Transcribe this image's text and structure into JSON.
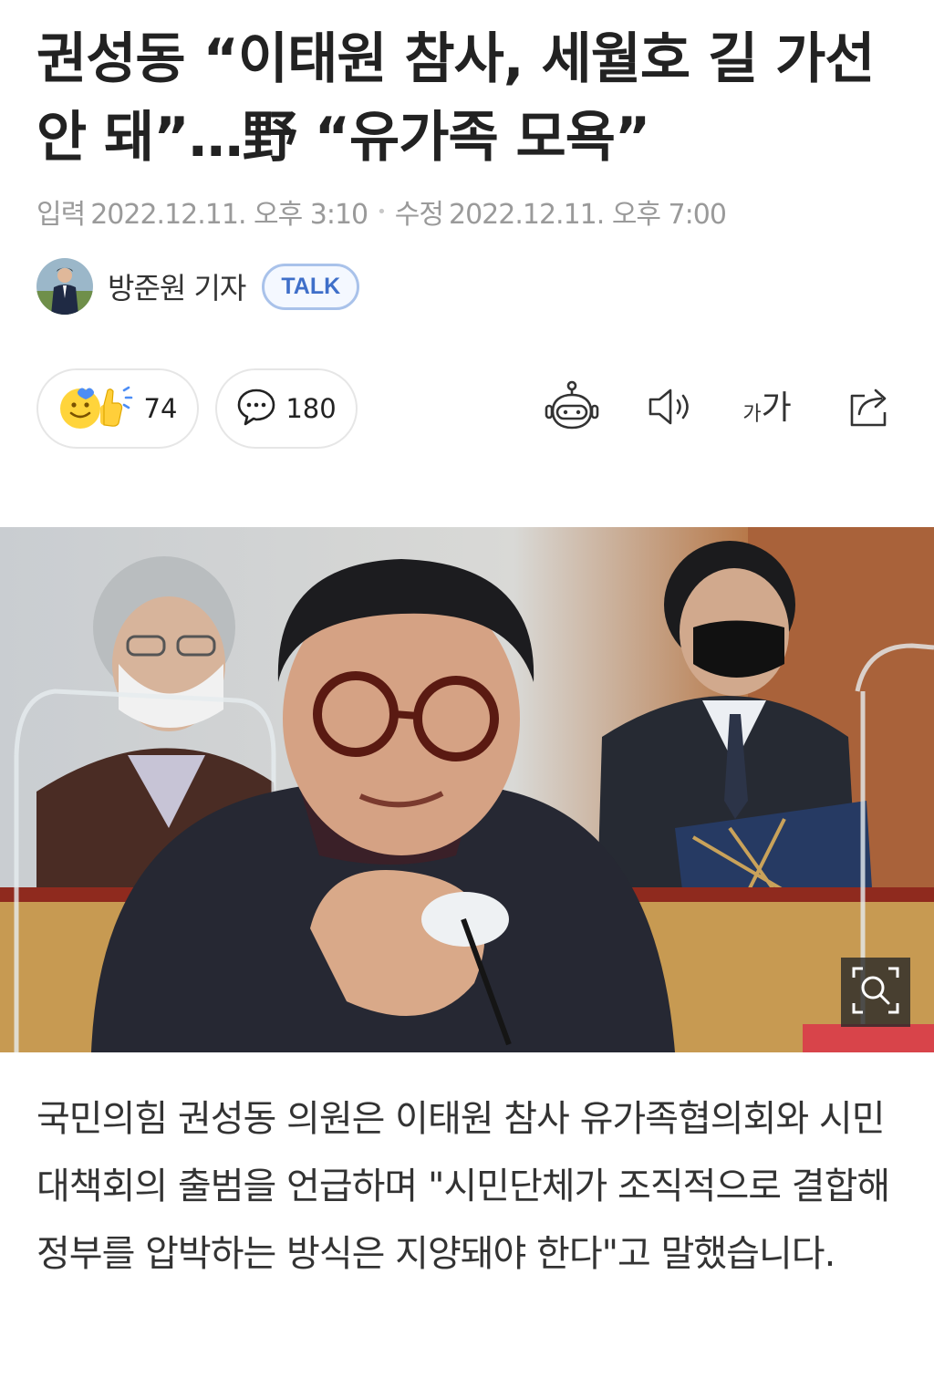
{
  "article": {
    "headline": "권성동 “이태원 참사, 세월호 길 가선 안 돼”…野 “유가족 모욕”",
    "published_label": "입력",
    "published": "2022.12.11. 오후 3:10",
    "modified_label": "수정",
    "modified": "2022.12.11. 오후 7:00",
    "author": "방준원 기자",
    "talk_label": "TALK"
  },
  "actions": {
    "reaction_count": "74",
    "comment_count": "180",
    "font_size_label_small": "가",
    "font_size_label_large": "가"
  },
  "icons": {
    "reaction": "smiley-thumbs-up-icon",
    "comment": "speech-bubble-icon",
    "summary": "robot-icon",
    "listen": "speaker-icon",
    "share": "share-icon",
    "zoom": "magnify-icon"
  },
  "caption": "국민의힘 권성동 의원은 이태원 참사 유가족협의회와 시민대책회의 출범을 언급하며 \"시민단체가 조직적으로 결합해 정부를 압박하는 방식은 지양돼야 한다\"고 말했습니다.",
  "colors": {
    "talk_accent": "#3f6fc9",
    "meta_gray": "#9a9a9a"
  }
}
